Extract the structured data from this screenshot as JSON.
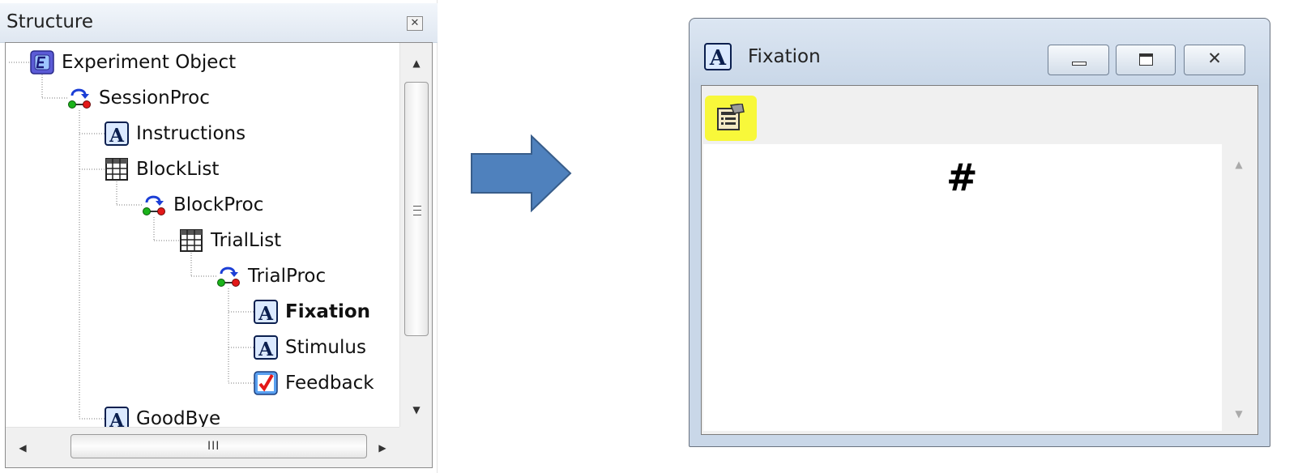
{
  "structure_panel": {
    "title": "Structure",
    "close_glyph": "✕",
    "hscroll_grip": "III",
    "tree": [
      {
        "label": "Experiment Object",
        "icon": "experiment-object-icon",
        "level": 0
      },
      {
        "label": "SessionProc",
        "icon": "procedure-icon",
        "level": 1
      },
      {
        "label": "Instructions",
        "icon": "text-display-icon",
        "level": 2
      },
      {
        "label": "BlockList",
        "icon": "list-grid-icon",
        "level": 2
      },
      {
        "label": "BlockProc",
        "icon": "procedure-icon",
        "level": 3
      },
      {
        "label": "TrialList",
        "icon": "list-grid-icon",
        "level": 4
      },
      {
        "label": "TrialProc",
        "icon": "procedure-icon",
        "level": 5
      },
      {
        "label": "Fixation",
        "icon": "text-display-icon",
        "level": 6,
        "selected": true
      },
      {
        "label": "Stimulus",
        "icon": "text-display-icon",
        "level": 6
      },
      {
        "label": "Feedback",
        "icon": "feedback-icon",
        "level": 6
      },
      {
        "label": "GoodBye",
        "icon": "text-display-icon",
        "level": 2
      }
    ]
  },
  "arrow": {
    "color": "#4f81bd",
    "border_color": "#385d8a"
  },
  "fixation_window": {
    "title": "Fixation",
    "display_text": "#",
    "toolbar_highlight_color": "#f8f83a",
    "buttons": {
      "minimize": "minimize",
      "maximize": "maximize",
      "close": "✕"
    }
  }
}
